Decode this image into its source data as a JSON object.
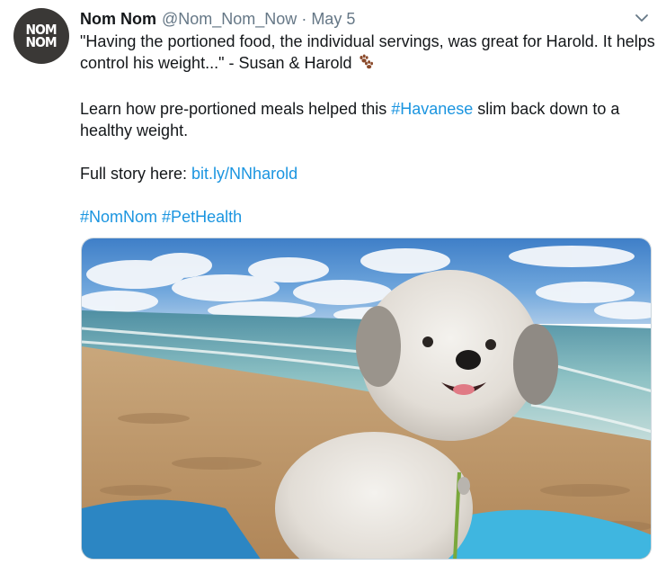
{
  "tweet": {
    "avatar_text_line1": "NOM",
    "avatar_text_line2": "NOM",
    "display_name": "Nom Nom",
    "handle": "@Nom_Nom_Now",
    "separator": "·",
    "date": "May 5",
    "quote": "\"Having the portioned food, the individual servings, was great for Harold. It helps control his weight...\" - Susan & Harold",
    "learn_prefix": "Learn how pre-portioned meals helped this ",
    "learn_hashtag": "#Havanese",
    "learn_suffix": " slim back down to a healthy weight.",
    "story_prefix": "Full story here: ",
    "story_link": "bit.ly/NNharold",
    "hashtag_1": "#NomNom",
    "hashtag_2": "#PetHealth",
    "media_description": "photo-dog-on-beach"
  },
  "icons": {
    "caret": "chevron-down-icon",
    "paw": "paw-prints-icon"
  },
  "colors": {
    "text": "#14171a",
    "muted": "#657786",
    "link": "#1b95e0",
    "avatar_bg": "#3a3836",
    "paw": "#8b4a2b"
  }
}
